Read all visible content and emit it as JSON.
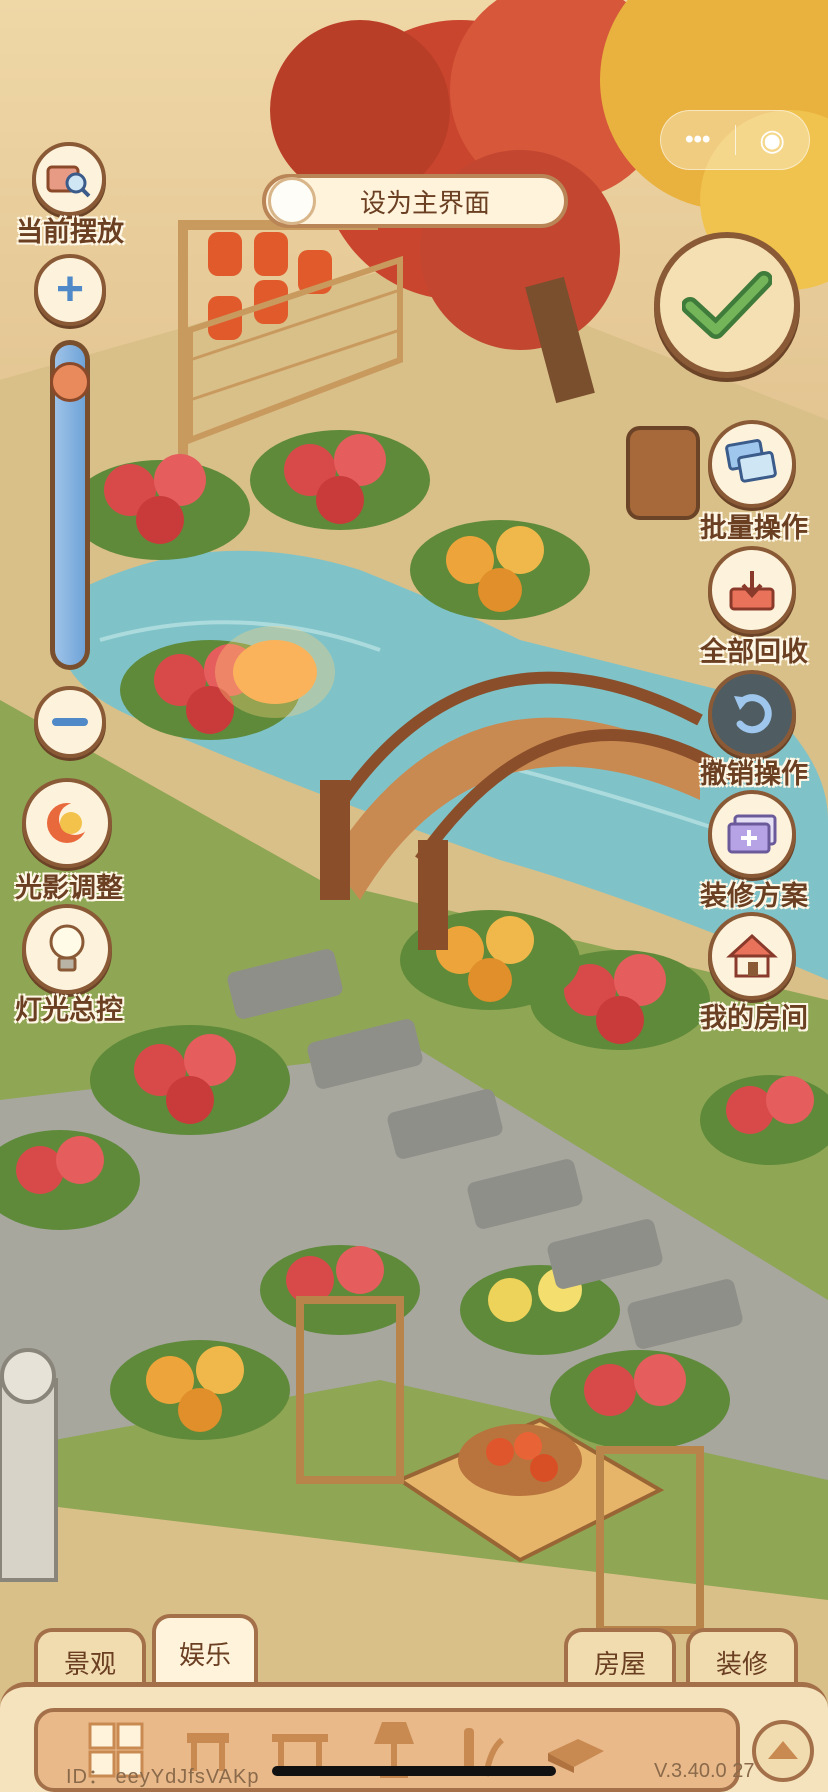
{
  "top": {
    "current_placement_label": "当前摆放",
    "set_main_label": "设为主界面",
    "capsule_more": "•••",
    "capsule_close": "◉"
  },
  "left_tools": {
    "lighting_label": "光影调整",
    "lights_label": "灯光总控",
    "zoom_level": 0.9
  },
  "right_tools": [
    {
      "label": "批量操作"
    },
    {
      "label": "全部回收"
    },
    {
      "label": "撤销操作"
    },
    {
      "label": "装修方案"
    },
    {
      "label": "我的房间"
    }
  ],
  "tabs": {
    "left": [
      "景观",
      "娱乐"
    ],
    "right": [
      "房屋",
      "装修"
    ],
    "active": "娱乐"
  },
  "footer": {
    "id_text": "ID：  eeyYdJfsVAKp",
    "version_text": "V.3.40.0  27"
  },
  "colors": {
    "frame": "#8a5a36",
    "label": "#6b3f22",
    "button_fill": "#fdf3dd",
    "water": "#7fc3c9",
    "foliage_red": "#c9452d",
    "foliage_gold": "#e9b13e"
  }
}
